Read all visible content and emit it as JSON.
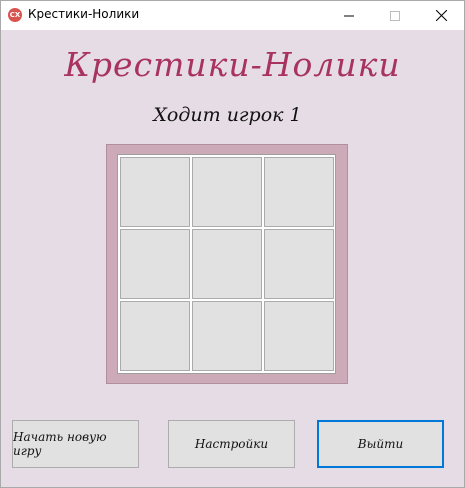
{
  "window": {
    "title": "Крестики-Нолики",
    "icon_text": "CX",
    "controls": [
      "minimize-icon",
      "maximize-icon",
      "close-icon"
    ]
  },
  "game": {
    "heading": "Крестики-Нолики",
    "status": "Ходит игрок 1",
    "board": [
      "",
      "",
      "",
      "",
      "",
      "",
      "",
      "",
      ""
    ]
  },
  "buttons": {
    "new_game": "Начать новую игру",
    "settings": "Настройки",
    "exit": "Выйти"
  },
  "colors": {
    "background": "#e6dce5",
    "heading": "#a8335f",
    "board_frame": "#ccaab8",
    "focus": "#0078d7"
  }
}
